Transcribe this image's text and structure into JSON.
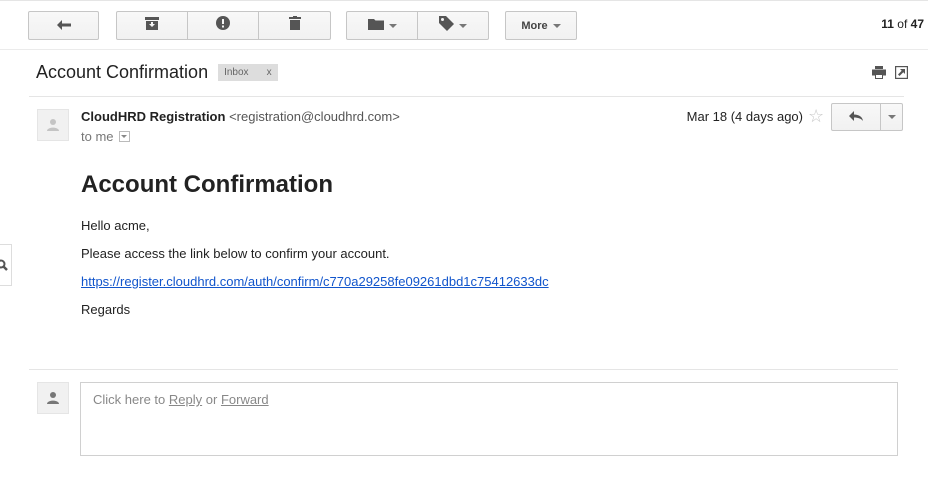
{
  "toolbar": {
    "back_icon": "back-arrow-icon",
    "archive_icon": "archive-icon",
    "spam_icon": "report-spam-icon",
    "delete_icon": "trash-icon",
    "move_icon": "folder-icon",
    "labels_icon": "tag-icon",
    "more_label": "More",
    "pager": {
      "current": "11",
      "of": "of",
      "total": "47"
    }
  },
  "thread": {
    "subject": "Account Confirmation",
    "label": "Inbox",
    "label_remove": "x",
    "print_icon": "print-icon",
    "popout_icon": "new-window-icon"
  },
  "message": {
    "sender_name": "CloudHRD Registration",
    "sender_email": "<registration@cloudhrd.com>",
    "to": "to me",
    "date": "Mar 18 (4 days ago)",
    "star_glyph": "☆",
    "reply_icon": "reply-icon",
    "heading": "Account Confirmation",
    "greeting": "Hello acme,",
    "instruction": "Please access the link below to confirm your account.",
    "link": "https://register.cloudhrd.com/auth/confirm/c770a29258fe09261dbd1c75412633dc",
    "closing": "Regards"
  },
  "reply_area": {
    "prefix": "Click here to",
    "reply": "Reply",
    "or": "or",
    "forward": "Forward"
  },
  "colors": {
    "link": "#1155cc",
    "label_bg": "#dddddd",
    "button_border": "#c6c6c6"
  }
}
